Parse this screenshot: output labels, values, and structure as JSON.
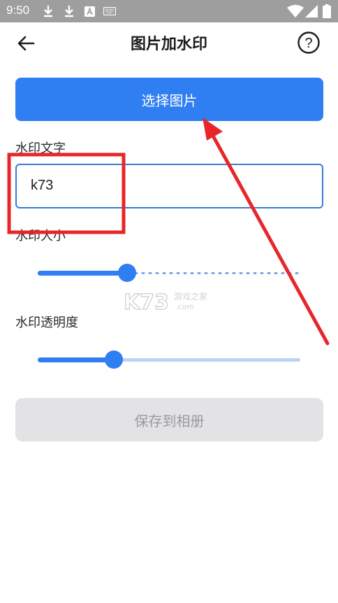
{
  "status_bar": {
    "time": "9:50",
    "icons": [
      "download-icon",
      "download-icon",
      "a-notification-icon",
      "keyboard-icon",
      "wifi-icon",
      "signal-icon",
      "battery-icon"
    ]
  },
  "app_bar": {
    "title": "图片加水印",
    "back_icon": "arrow-left-icon",
    "help_icon": "help-circle-icon",
    "help_glyph": "?"
  },
  "select_button": {
    "label": "选择图片"
  },
  "watermark_text": {
    "label": "水印文字",
    "value": "k73"
  },
  "watermark_size": {
    "label": "水印大小",
    "value_fraction": 0.34
  },
  "watermark_opacity": {
    "label": "水印透明度",
    "value_fraction": 0.29
  },
  "save_button": {
    "label": "保存到相册",
    "enabled": false
  },
  "overlay_watermark": {
    "text": "K73",
    "subtext": "游戏之家",
    "domain": ".com"
  },
  "colors": {
    "primary": "#2f7ef2",
    "annotation_red": "#e8262a",
    "status_bar": "#9e9e9e",
    "disabled_bg": "#e3e3e5",
    "disabled_text": "#9b9b9f"
  }
}
